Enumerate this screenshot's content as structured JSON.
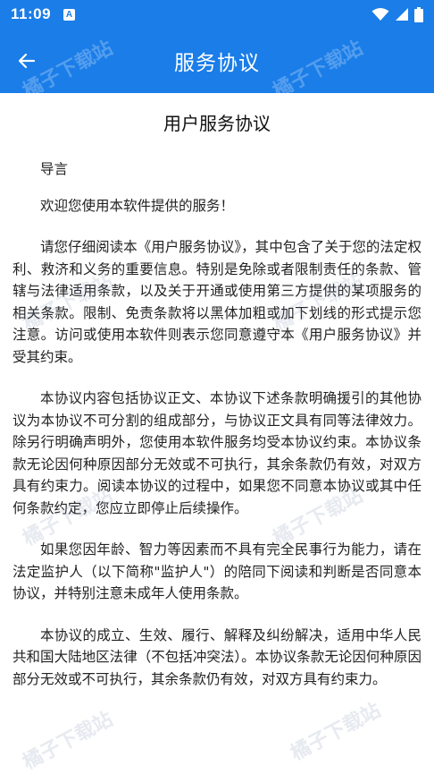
{
  "status": {
    "time": "11:09",
    "notif_letter": "A"
  },
  "appbar": {
    "title": "服务协议"
  },
  "document": {
    "title": "用户服务协议",
    "paragraphs": [
      "导言",
      "欢迎您使用本软件提供的服务！",
      "请您仔细阅读本《用户服务协议》，其中包含了关于您的法定权利、救济和义务的重要信息。特别是免除或者限制责任的条款、管辖与法律适用条款，以及关于开通或使用第三方提供的某项服务的相关条款。限制、免责条款将以黑体加粗或加下划线的形式提示您注意。访问或使用本软件则表示您同意遵守本《用户服务协议》并受其约束。",
      "本协议内容包括协议正文、本协议下述条款明确援引的其他协议为本协议不可分割的组成部分，与协议正文具有同等法律效力。除另行明确声明外，您使用本软件服务均受本协议约束。本协议条款无论因何种原因部分无效或不可执行，其余条款仍有效，对双方具有约束力。阅读本协议的过程中，如果您不同意本协议或其中任何条款约定，您应立即停止后续操作。",
      "如果您因年龄、智力等因素而不具有完全民事行为能力，请在法定监护人（以下简称\"监护人\"）的陪同下阅读和判断是否同意本协议，并特别注意未成年人使用条款。",
      "本协议的成立、生效、履行、解释及纠纷解决，适用中华人民共和国大陆地区法律（不包括冲突法）。本协议条款无论因何种原因部分无效或不可执行，其余条款仍有效，对双方具有约束力。"
    ]
  },
  "watermark": {
    "text": "橘子下载站"
  },
  "colors": {
    "primary": "#1a7de8"
  }
}
